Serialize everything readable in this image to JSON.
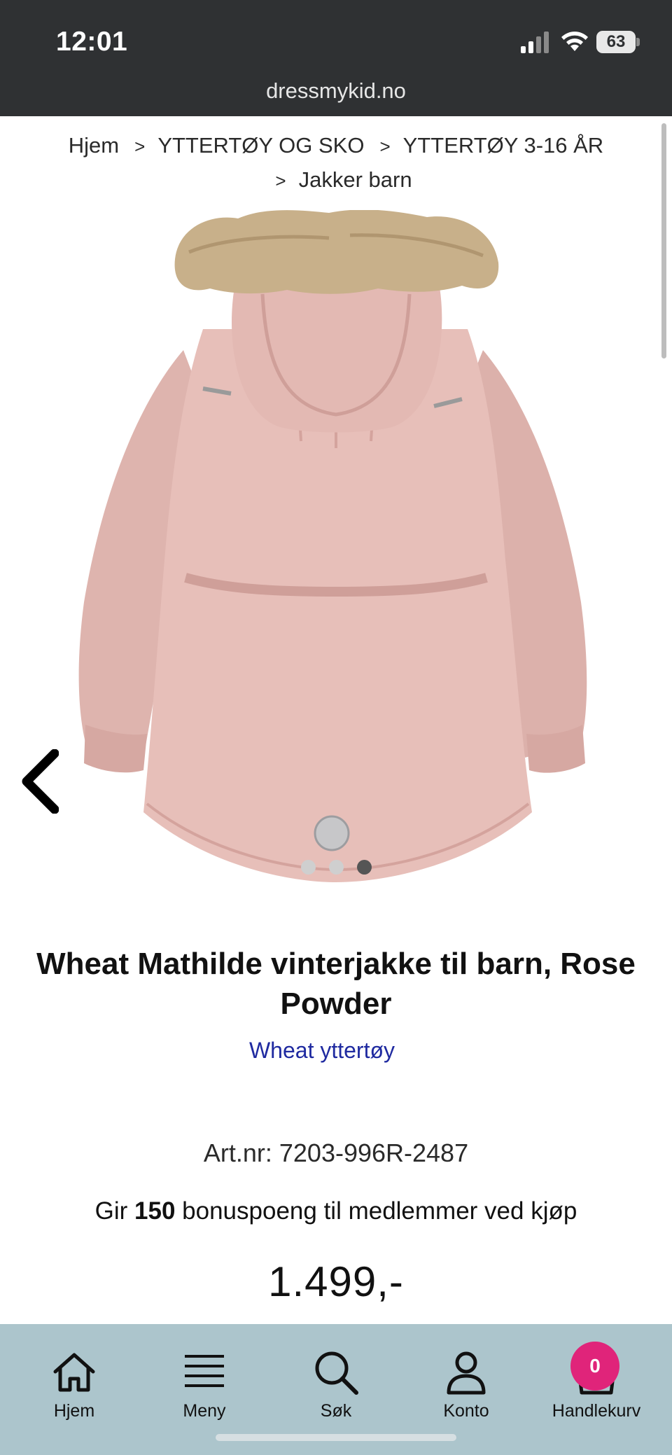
{
  "status_bar": {
    "time": "12:01",
    "battery_level": "63",
    "url": "dressmykid.no"
  },
  "breadcrumb": {
    "items": [
      "Hjem",
      "YTTERTØY OG SKO",
      "YTTERTØY 3-16 ÅR",
      "Jakker barn"
    ]
  },
  "product": {
    "image_slides_count": 3,
    "active_slide": 3,
    "title": "Wheat Mathilde vinterjakke til barn, Rose Powder",
    "brand_link": "Wheat yttertøy",
    "art_nr": "Art.nr: 7203-996R-2487",
    "bonus_prefix": "Gir ",
    "bonus_points": "150",
    "bonus_suffix": " bonuspoeng til medlemmer ved kjøp",
    "price": "1.499,-"
  },
  "bottom_nav": {
    "items": [
      {
        "label": "Hjem",
        "icon": "home-icon"
      },
      {
        "label": "Meny",
        "icon": "menu-icon"
      },
      {
        "label": "Søk",
        "icon": "search-icon"
      },
      {
        "label": "Konto",
        "icon": "account-icon"
      },
      {
        "label": "Handlekurv",
        "icon": "cart-icon"
      }
    ],
    "cart_count": "0"
  },
  "colors": {
    "status_bar": "#2f3133",
    "brand_link": "#1f2aa0",
    "bottom_nav": "#acc5cc",
    "cart_badge": "#e0247a",
    "jacket": "#e7bfb9"
  }
}
